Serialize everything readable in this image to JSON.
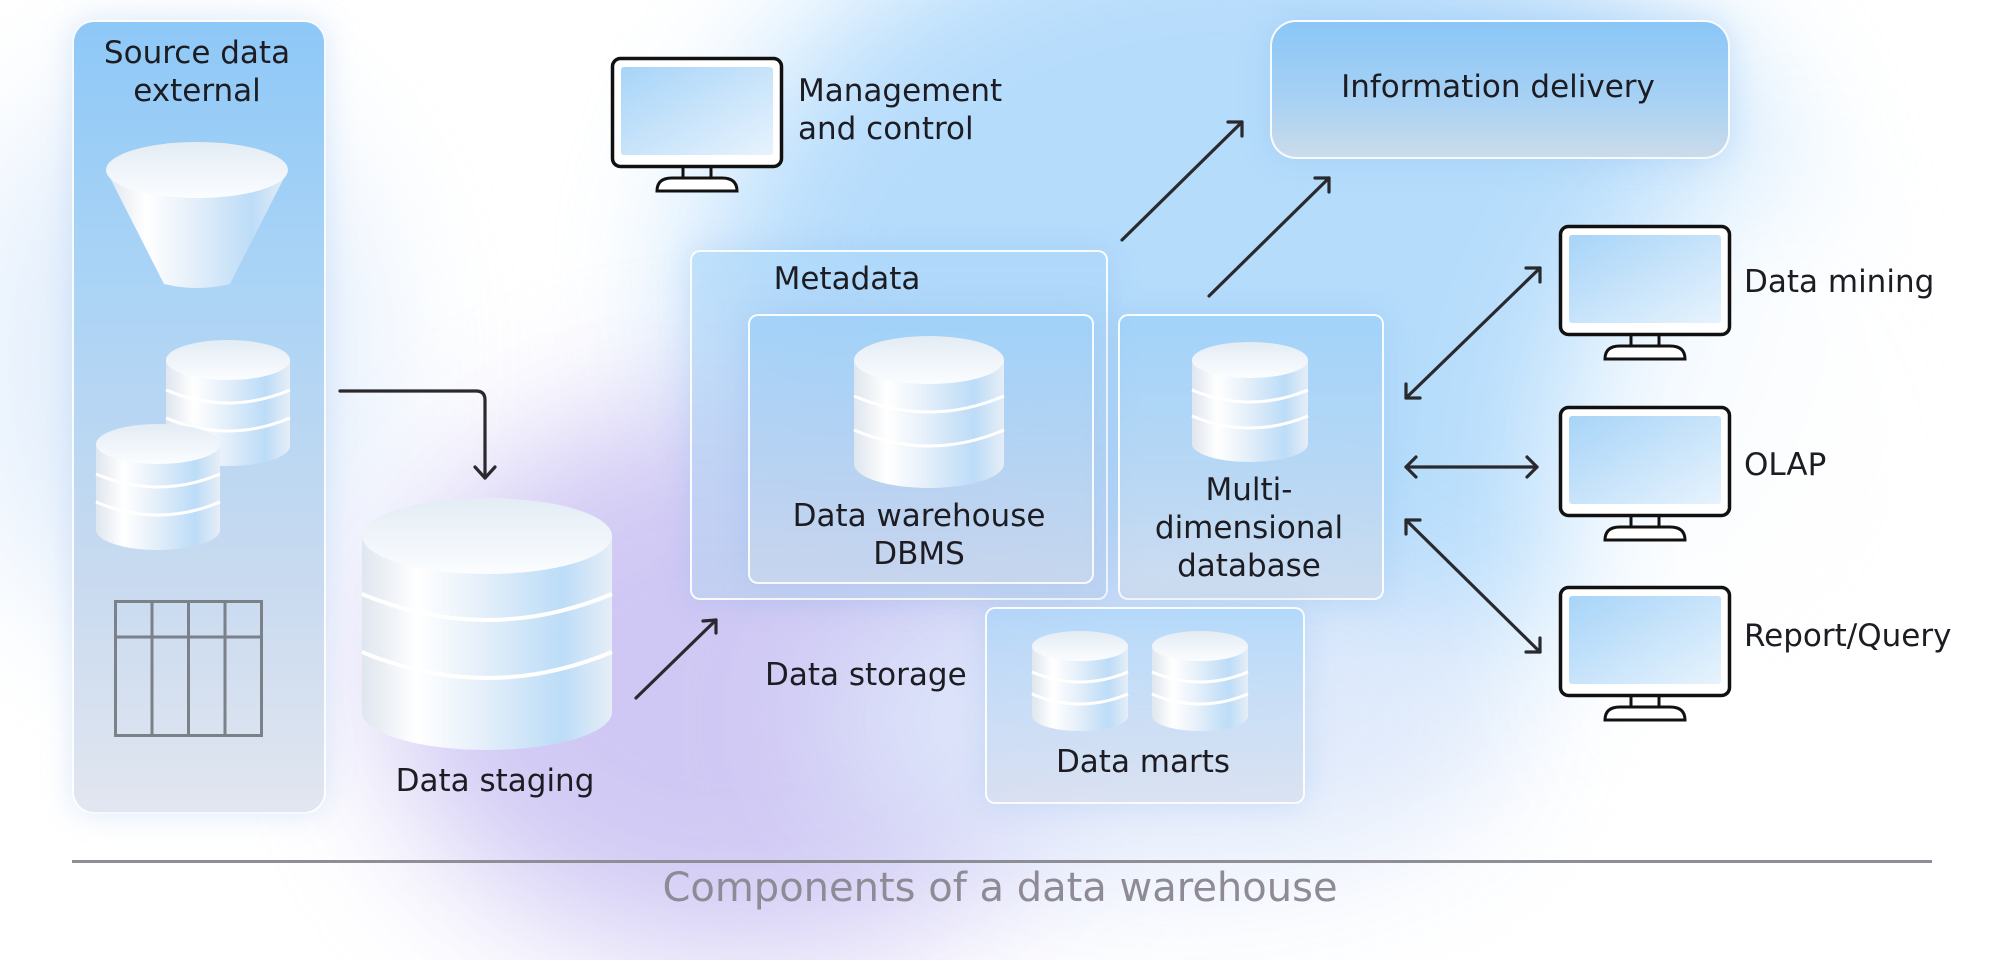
{
  "diagram": {
    "title": "Components of a data warehouse",
    "nodes": {
      "source": {
        "line1": "Source data",
        "line2": "external"
      },
      "staging": {
        "label": "Data staging"
      },
      "management": {
        "line1": "Management",
        "line2": "and control"
      },
      "metadata": {
        "label": "Metadata"
      },
      "dw_dbms": {
        "line1": "Data warehouse",
        "line2": "DBMS"
      },
      "mdb": {
        "line1": "Multi-",
        "line2": "dimensional",
        "line3": "database"
      },
      "storage": {
        "label": "Data storage"
      },
      "marts": {
        "label": "Data marts"
      },
      "delivery": {
        "label": "Information delivery"
      },
      "mining": {
        "label": "Data mining"
      },
      "olap": {
        "label": "OLAP"
      },
      "report": {
        "label": "Report/Query"
      }
    },
    "edges": [
      {
        "from": "Source data external",
        "to": "Data staging",
        "type": "elbow-arrow"
      },
      {
        "from": "Data staging",
        "to": "Data storage",
        "type": "arrow"
      },
      {
        "from": "Metadata",
        "to": "Information delivery",
        "type": "arrow"
      },
      {
        "from": "Multi-dimensional database",
        "to": "Information delivery",
        "type": "arrow"
      },
      {
        "from": "Multi-dimensional database",
        "to": "Data mining",
        "type": "bidirectional"
      },
      {
        "from": "Multi-dimensional database",
        "to": "OLAP",
        "type": "bidirectional"
      },
      {
        "from": "Multi-dimensional database",
        "to": "Report/Query",
        "type": "bidirectional"
      }
    ],
    "colors": {
      "accent_blue": "#8ec8f7",
      "accent_violet": "#cbc3f3",
      "stroke": "#222222",
      "caption": "#8e8b96"
    }
  }
}
